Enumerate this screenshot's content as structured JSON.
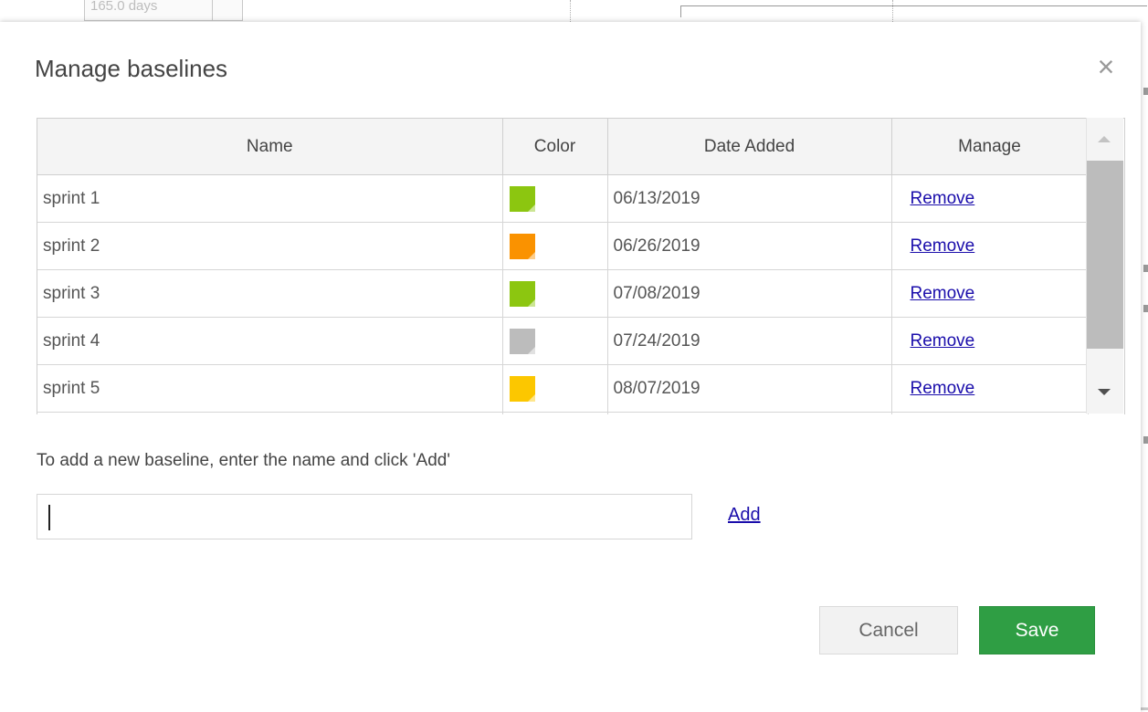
{
  "background": {
    "partial_cell_text": "165.0 days"
  },
  "dialog": {
    "title": "Manage baselines",
    "close_symbol": "×"
  },
  "table": {
    "headers": {
      "name": "Name",
      "color": "Color",
      "date_added": "Date Added",
      "manage": "Manage"
    },
    "rows": [
      {
        "name": "sprint 1",
        "color": "#8cc610",
        "date": "06/13/2019",
        "action": "Remove"
      },
      {
        "name": "sprint 2",
        "color": "#fa9200",
        "date": "06/26/2019",
        "action": "Remove"
      },
      {
        "name": "sprint 3",
        "color": "#8cc610",
        "date": "07/08/2019",
        "action": "Remove"
      },
      {
        "name": "sprint 4",
        "color": "#bcbcbc",
        "date": "07/24/2019",
        "action": "Remove"
      },
      {
        "name": "sprint 5",
        "color": "#fcc700",
        "date": "08/07/2019",
        "action": "Remove"
      }
    ]
  },
  "add_section": {
    "hint": "To add a new baseline, enter the name and click 'Add'",
    "input_value": "",
    "add_label": "Add"
  },
  "footer": {
    "cancel_label": "Cancel",
    "save_label": "Save"
  },
  "icons": {
    "close": "close-icon",
    "scroll_up": "scroll-up-arrow-icon",
    "scroll_down": "scroll-down-arrow-icon"
  }
}
